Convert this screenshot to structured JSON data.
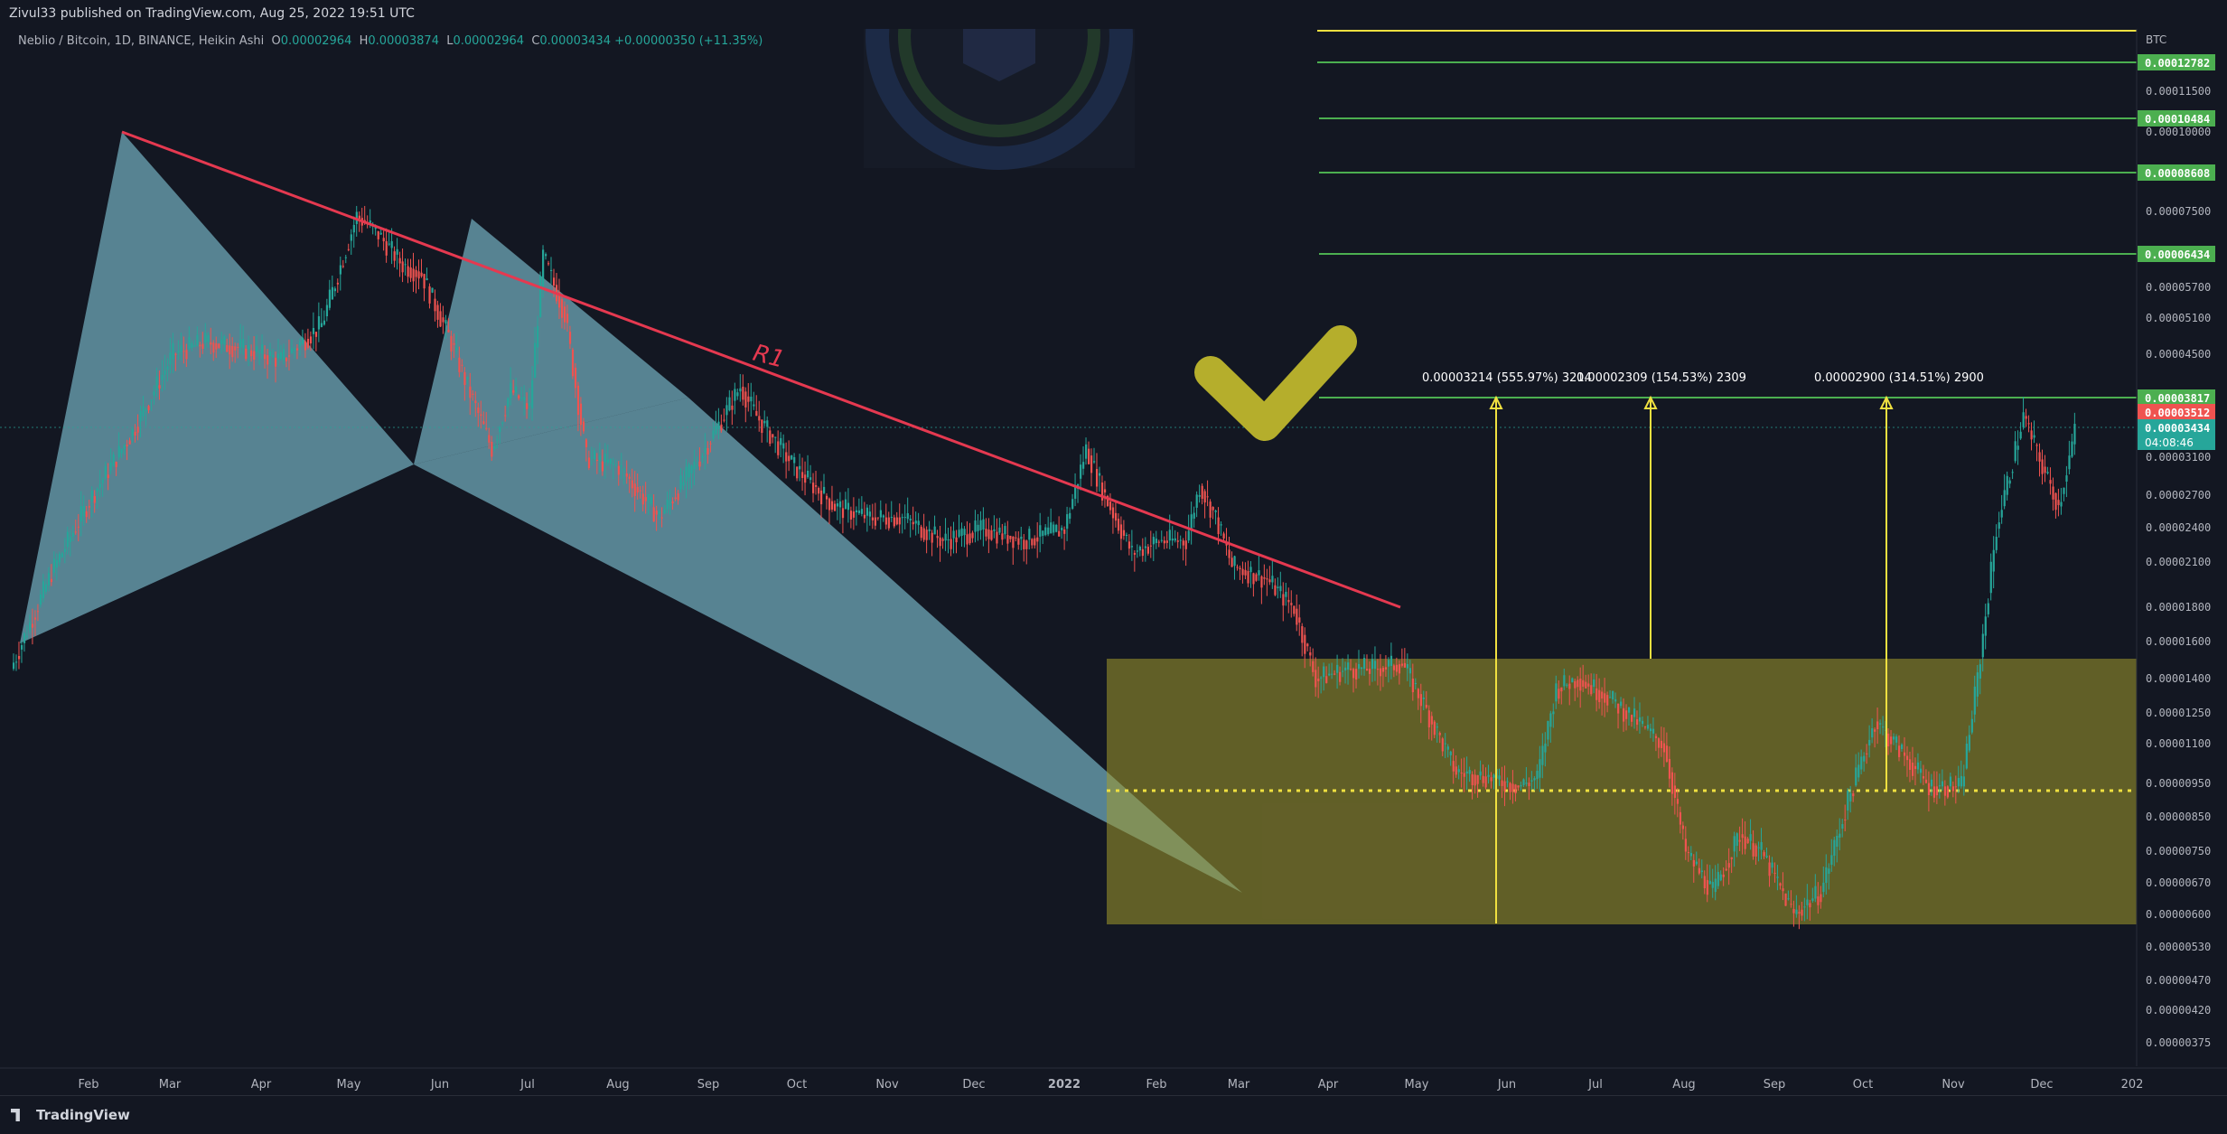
{
  "header": {
    "published": "Zivul33 published on TradingView.com, Aug 25, 2022 19:51 UTC",
    "symbol": "Neblio / Bitcoin, 1D, BINANCE, Heikin Ashi",
    "o_label": "O",
    "o_value": "0.00002964",
    "h_label": "H",
    "h_value": "0.00003874",
    "l_label": "L",
    "l_value": "0.00002964",
    "c_label": "C",
    "c_value": "0.00003434",
    "change": "+0.00000350 (+11.35%)"
  },
  "footer": {
    "brand": "TradingView"
  },
  "colors": {
    "background": "#131722",
    "up": "#26a69a",
    "down": "#ef5350",
    "trendline": "#e53950",
    "zone": "#a39a2c",
    "fib": "#4caf50",
    "yellow": "#f0e040",
    "triangle": "#6fa8b8"
  },
  "chart_data": {
    "type": "candlestick",
    "currency_label": "BTC",
    "x_tick_labels": [
      "Feb",
      "Mar",
      "Apr",
      "May",
      "Jun",
      "Jul",
      "Aug",
      "Sep",
      "Oct",
      "Nov",
      "Dec",
      "2022",
      "Feb",
      "Mar",
      "Apr",
      "May",
      "Jun",
      "Jul",
      "Aug",
      "Sep",
      "Oct",
      "Nov",
      "Dec",
      "202"
    ],
    "y_tick_labels": [
      "0.00011500",
      "0.00010000",
      "0.00007500",
      "0.00005700",
      "0.00005100",
      "0.00004500",
      "0.00003100",
      "0.00002700",
      "0.00002400",
      "0.00002100",
      "0.00001800",
      "0.00001600",
      "0.00001400",
      "0.00001250",
      "0.00001100",
      "0.00000950",
      "0.00000850",
      "0.00000750",
      "0.00000670",
      "0.00000600",
      "0.00000530",
      "0.00000470",
      "0.00000420",
      "0.00000375"
    ],
    "price_labels": [
      {
        "text": "0.00012782",
        "kind": "fib"
      },
      {
        "text": "0.00010484",
        "kind": "fib"
      },
      {
        "text": "0.00008608",
        "kind": "fib"
      },
      {
        "text": "0.00006434",
        "kind": "fib"
      },
      {
        "text": "0.00003817",
        "kind": "fib"
      },
      {
        "text": "0.00003512",
        "kind": "high"
      },
      {
        "text": "0.00003434",
        "kind": "last"
      }
    ],
    "countdown": "04:08:46",
    "annotations": {
      "trendline_label": "R1",
      "measure_1": "0.00003214 (555.97%) 3214",
      "measure_2": "0.00002309 (154.53%) 2309",
      "measure_3": "0.00002900 (314.51%) 2900"
    },
    "series": [
      {
        "name": "",
        "anchor_points": [
          [
            0,
            1.45e-05
          ],
          [
            15,
            2.05e-05
          ],
          [
            30,
            2.7e-05
          ],
          [
            45,
            3.4e-05
          ],
          [
            60,
            4.5e-05
          ],
          [
            72,
            4.7e-05
          ],
          [
            85,
            4.6e-05
          ],
          [
            100,
            4.4e-05
          ],
          [
            115,
            5e-05
          ],
          [
            128,
            7.4e-05
          ],
          [
            135,
            7e-05
          ],
          [
            145,
            6.2e-05
          ],
          [
            152,
            6e-05
          ],
          [
            162,
            4.8e-05
          ],
          [
            170,
            3.9e-05
          ],
          [
            178,
            3.2e-05
          ],
          [
            185,
            3.95e-05
          ],
          [
            192,
            3.7e-05
          ],
          [
            197,
            6.4e-05
          ],
          [
            205,
            5.2e-05
          ],
          [
            213,
            3.1e-05
          ],
          [
            225,
            3e-05
          ],
          [
            240,
            2.5e-05
          ],
          [
            255,
            3.1e-05
          ],
          [
            270,
            4e-05
          ],
          [
            276,
            3.6e-05
          ],
          [
            290,
            3e-05
          ],
          [
            305,
            2.6e-05
          ],
          [
            318,
            2.5e-05
          ],
          [
            330,
            2.5e-05
          ],
          [
            345,
            2.3e-05
          ],
          [
            360,
            2.4e-05
          ],
          [
            375,
            2.3e-05
          ],
          [
            390,
            2.4e-05
          ],
          [
            398,
            3.2e-05
          ],
          [
            405,
            2.7e-05
          ],
          [
            415,
            2.2e-05
          ],
          [
            425,
            2.3e-05
          ],
          [
            435,
            2.3e-05
          ],
          [
            440,
            2.8e-05
          ],
          [
            446,
            2.5e-05
          ],
          [
            452,
            2.1e-05
          ],
          [
            465,
            2e-05
          ],
          [
            475,
            1.8e-05
          ],
          [
            483,
            1.4e-05
          ],
          [
            495,
            1.45e-05
          ],
          [
            505,
            1.45e-05
          ],
          [
            515,
            1.48e-05
          ],
          [
            522,
            1.3e-05
          ],
          [
            535,
            1e-05
          ],
          [
            548,
            9.8e-06
          ],
          [
            558,
            9.5e-06
          ],
          [
            565,
            9.8e-06
          ],
          [
            572,
            1.35e-05
          ],
          [
            580,
            1.4e-05
          ],
          [
            590,
            1.32e-05
          ],
          [
            602,
            1.2e-05
          ],
          [
            612,
            1.1e-05
          ],
          [
            620,
            7.5e-06
          ],
          [
            630,
            6.5e-06
          ],
          [
            640,
            8e-06
          ],
          [
            648,
            7.5e-06
          ],
          [
            660,
            6e-06
          ],
          [
            670,
            6.5e-06
          ],
          [
            680,
            9e-06
          ],
          [
            690,
            1.2e-05
          ],
          [
            698,
            1.1e-05
          ],
          [
            710,
            9.5e-06
          ],
          [
            722,
            9.5e-06
          ],
          [
            728,
            1.4e-05
          ],
          [
            735,
            2.4e-05
          ],
          [
            745,
            3.6e-05
          ],
          [
            752,
            3e-05
          ],
          [
            758,
            2.6e-05
          ],
          [
            764,
            3.4e-05
          ]
        ]
      }
    ],
    "y_scale": "log",
    "grid": false
  }
}
